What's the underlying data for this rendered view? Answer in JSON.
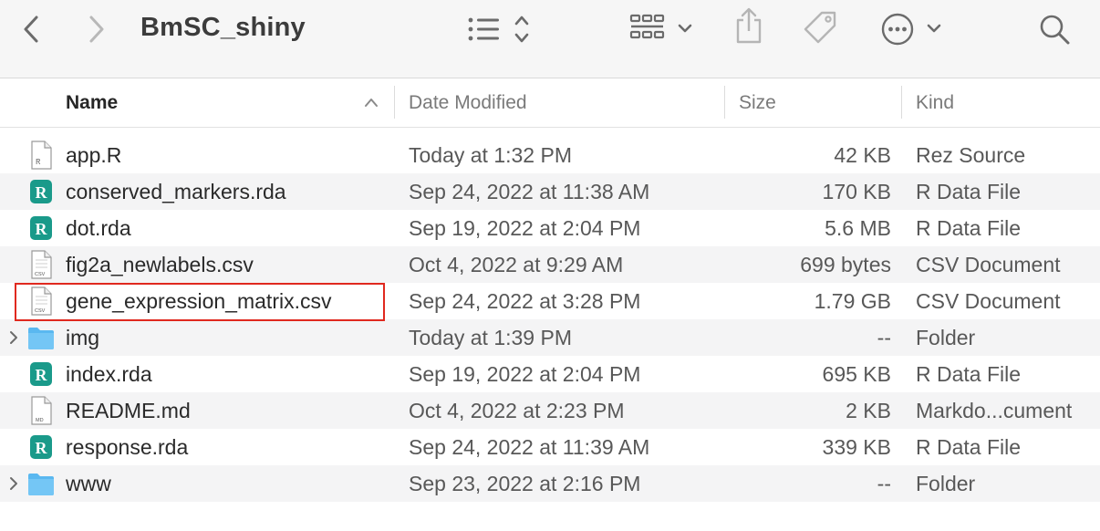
{
  "window": {
    "title": "BmSC_shiny"
  },
  "toolbar": {
    "back_icon": "chevron-left-icon",
    "forward_icon": "chevron-right-icon",
    "view_icon": "list-view-icon",
    "group_icon": "group-grid-icon",
    "share_icon": "share-icon",
    "tag_icon": "tag-icon",
    "more_icon": "ellipsis-circle-icon",
    "search_icon": "search-icon"
  },
  "columns": {
    "name": "Name",
    "date": "Date Modified",
    "size": "Size",
    "kind": "Kind"
  },
  "files": [
    {
      "name": "app.R",
      "date": "Today at 1:32 PM",
      "size": "42 KB",
      "kind": "Rez Source",
      "icon": "r-script-doc-icon"
    },
    {
      "name": "conserved_markers.rda",
      "date": "Sep 24, 2022 at 11:38 AM",
      "size": "170 KB",
      "kind": "R Data File",
      "icon": "r-data-icon"
    },
    {
      "name": "dot.rda",
      "date": "Sep 19, 2022 at 2:04 PM",
      "size": "5.6 MB",
      "kind": "R Data File",
      "icon": "r-data-icon"
    },
    {
      "name": "fig2a_newlabels.csv",
      "date": "Oct 4, 2022 at 9:29 AM",
      "size": "699 bytes",
      "kind": "CSV Document",
      "icon": "csv-doc-icon"
    },
    {
      "name": "gene_expression_matrix.csv",
      "date": "Sep 24, 2022 at 3:28 PM",
      "size": "1.79 GB",
      "kind": "CSV Document",
      "icon": "csv-doc-icon"
    },
    {
      "name": "img",
      "date": "Today at 1:39 PM",
      "size": "--",
      "kind": "Folder",
      "icon": "folder-icon"
    },
    {
      "name": "index.rda",
      "date": "Sep 19, 2022 at 2:04 PM",
      "size": "695 KB",
      "kind": "R Data File",
      "icon": "r-data-icon"
    },
    {
      "name": "README.md",
      "date": "Oct 4, 2022 at 2:23 PM",
      "size": "2 KB",
      "kind": "Markdo...cument",
      "icon": "md-doc-icon"
    },
    {
      "name": "response.rda",
      "date": "Sep 24, 2022 at 11:39 AM",
      "size": "339 KB",
      "kind": "R Data File",
      "icon": "r-data-icon"
    },
    {
      "name": "www",
      "date": "Sep 23, 2022 at 2:16 PM",
      "size": "--",
      "kind": "Folder",
      "icon": "folder-icon"
    }
  ],
  "icon_labels": {
    "csv": "CSV",
    "md": "MD",
    "r": "R"
  },
  "colors": {
    "highlight": "#e0291f",
    "folder": "#5ab8f0",
    "r_icon": "#1a9a8a"
  }
}
